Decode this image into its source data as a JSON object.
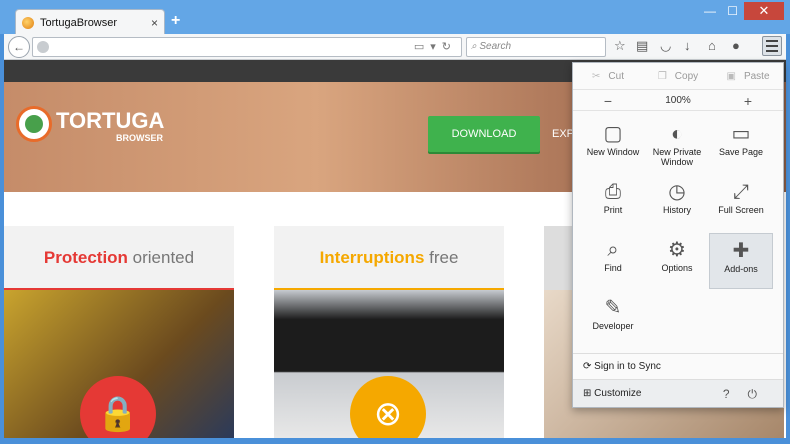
{
  "tab": {
    "title": "TortugaBrowser",
    "close": "×"
  },
  "newtab": "+",
  "window": {
    "min": "—",
    "max": "☐",
    "close": "✕"
  },
  "nav": {
    "back": "←",
    "search_placeholder": "Search"
  },
  "toolbar_icons": [
    "star-icon",
    "reading-list-icon",
    "pocket-icon",
    "download-icon",
    "home-icon",
    "chat-icon"
  ],
  "hero": {
    "logo": "TORTUGA",
    "logo_sub": "BROWSER",
    "download_label": "DOWNLOAD",
    "explore_label": "EXPL"
  },
  "cards": [
    {
      "title_bold": "Protection",
      "title_rest": " oriented",
      "bold_color": "#e53935",
      "rule_color": "#e53935",
      "circle_color": "#e53935",
      "icon": "🔒"
    },
    {
      "title_bold": "Interruptions",
      "title_rest": " free",
      "bold_color": "#f5a800",
      "rule_color": "#f5a800",
      "circle_color": "#f5a800",
      "icon": "⊗"
    }
  ],
  "menu": {
    "cut": "Cut",
    "copy": "Copy",
    "paste": "Paste",
    "zoom_out": "−",
    "zoom_level": "100%",
    "zoom_in": "+",
    "items": [
      {
        "label": "New Window",
        "icon": "▢"
      },
      {
        "label": "New Private Window",
        "icon": "◐"
      },
      {
        "label": "Save Page",
        "icon": "▭"
      },
      {
        "label": "Print",
        "icon": "⎙"
      },
      {
        "label": "History",
        "icon": "◷"
      },
      {
        "label": "Full Screen",
        "icon": "⤢"
      },
      {
        "label": "Find",
        "icon": "⌕"
      },
      {
        "label": "Options",
        "icon": "⚙"
      },
      {
        "label": "Add-ons",
        "icon": "✚"
      },
      {
        "label": "Developer",
        "icon": "✎"
      }
    ],
    "sync": "Sign in to Sync",
    "customize": "Customize",
    "help": "?",
    "quit": "⏻"
  }
}
